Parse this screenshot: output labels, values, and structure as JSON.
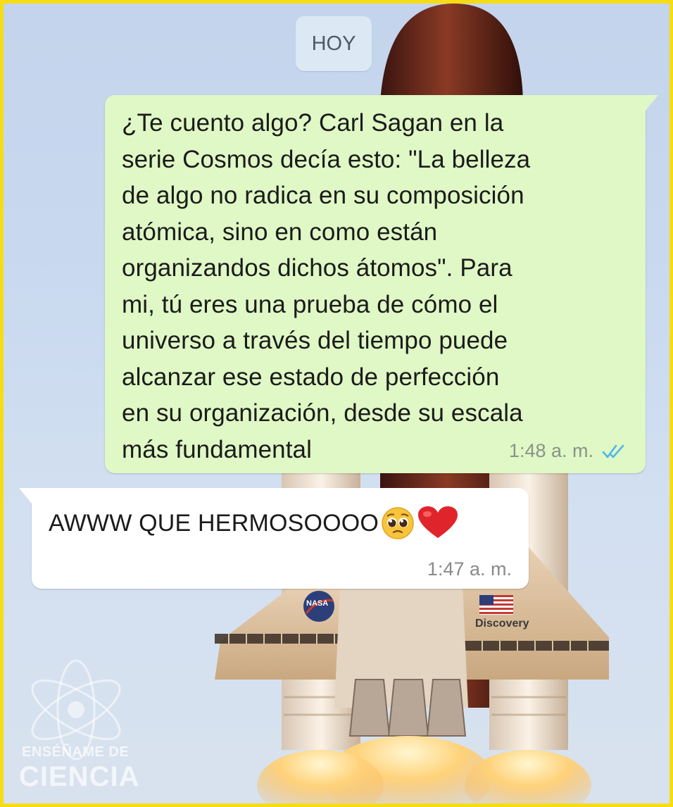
{
  "chat": {
    "date_label": "HOY",
    "outgoing": {
      "text": "¿Te cuento algo? Carl Sagan en la\nserie Cosmos decía esto: \"La belleza\nde algo no radica en su composición\natómica, sino en como están\norganizandos dichos átomos\". Para\nmi, tú eres una prueba de cómo el\nuniverso a través del tiempo puede\nalcanzar ese estado de  perfección\nen su organización, desde su escala\nmás fundamental",
      "time": "1:48 a. m.",
      "status_icon": "double-check-read-icon",
      "status_color": "#4fb7e8"
    },
    "incoming": {
      "text": "AWWW QUE HERMOSOOOO",
      "emojis": [
        "pleading-face-icon",
        "red-heart-icon"
      ],
      "time": "1:47 a. m."
    }
  },
  "background": {
    "shuttle_labels": [
      "NASA",
      "Discovery"
    ]
  },
  "watermark": {
    "line1": "ENSÉÑAME DE",
    "line2": "CIENCIA"
  },
  "colors": {
    "frame_border": "#f6dd13",
    "outgoing_bubble": "#dff8c5",
    "incoming_bubble": "#ffffff",
    "date_chip": "#dce9f4"
  }
}
